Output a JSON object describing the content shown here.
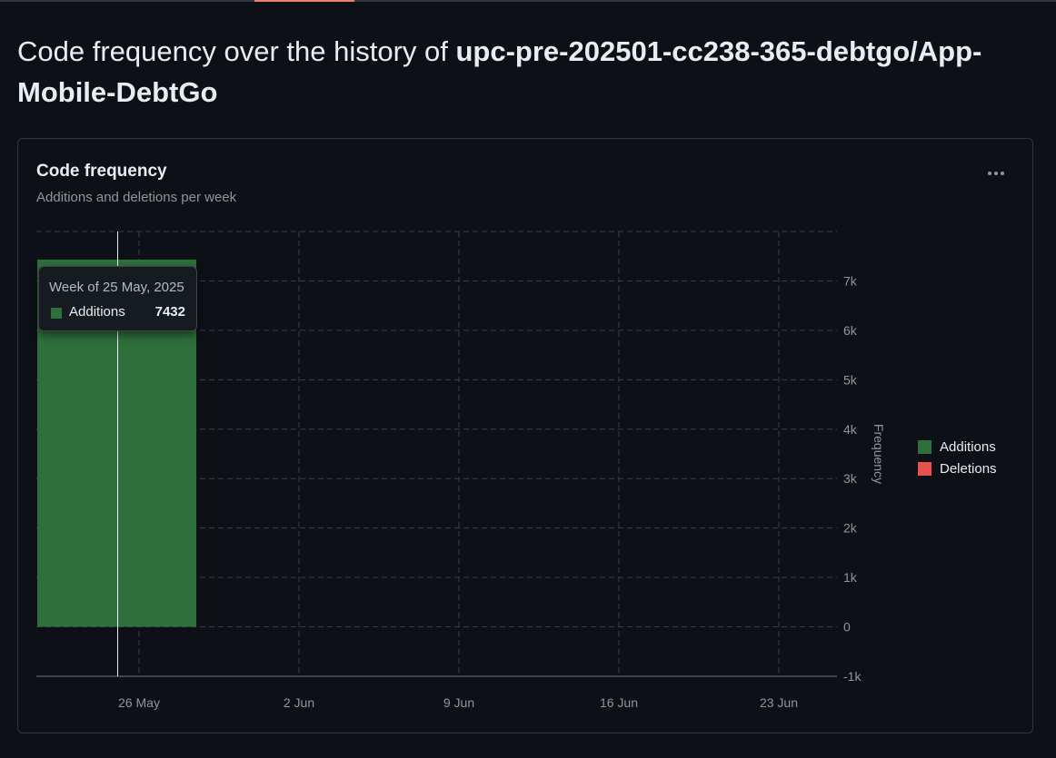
{
  "page": {
    "title_prefix": "Code frequency over the history of ",
    "repo_name": "upc-pre-202501-cc238-365-debtgo/App-Mobile-DebtGo"
  },
  "card": {
    "title": "Code frequency",
    "subtitle": "Additions and deletions per week",
    "menu_icon": "kebab-horizontal-icon"
  },
  "tooltip": {
    "title": "Week of 25 May, 2025",
    "series_name": "Additions",
    "value": "7432"
  },
  "chart_data": {
    "type": "bar",
    "title": "Code frequency",
    "subtitle": "Additions and deletions per week",
    "xlabel": "",
    "ylabel": "Frequency",
    "x_ticks": [
      "26 May",
      "2 Jun",
      "9 Jun",
      "16 Jun",
      "23 Jun"
    ],
    "x_tick_days_from_may_26": [
      0,
      7,
      14,
      21,
      28
    ],
    "y_ticks": [
      -1000,
      0,
      1000,
      2000,
      3000,
      4000,
      5000,
      6000,
      7000
    ],
    "y_tick_labels": [
      "-1k",
      "0",
      "1k",
      "2k",
      "3k",
      "4k",
      "5k",
      "6k",
      "7k"
    ],
    "ylim": [
      -1000,
      8000
    ],
    "categories": [
      "Week of 25 May, 2025"
    ],
    "series": [
      {
        "name": "Additions",
        "color": "#2f6f3b",
        "values": [
          7432
        ]
      },
      {
        "name": "Deletions",
        "color": "#e5534b",
        "values": [
          0
        ]
      }
    ],
    "grid": true,
    "legend_position": "right",
    "hover_category": "Week of 25 May, 2025"
  },
  "legend": {
    "items": [
      {
        "label": "Additions",
        "color": "#2f6f3b"
      },
      {
        "label": "Deletions",
        "color": "#e5534b"
      }
    ]
  },
  "colors": {
    "background": "#0d1117",
    "border": "#30363d",
    "additions": "#2f6f3b",
    "deletions": "#e5534b",
    "grid": "#3a3f46",
    "muted_text": "#8d96a0"
  }
}
